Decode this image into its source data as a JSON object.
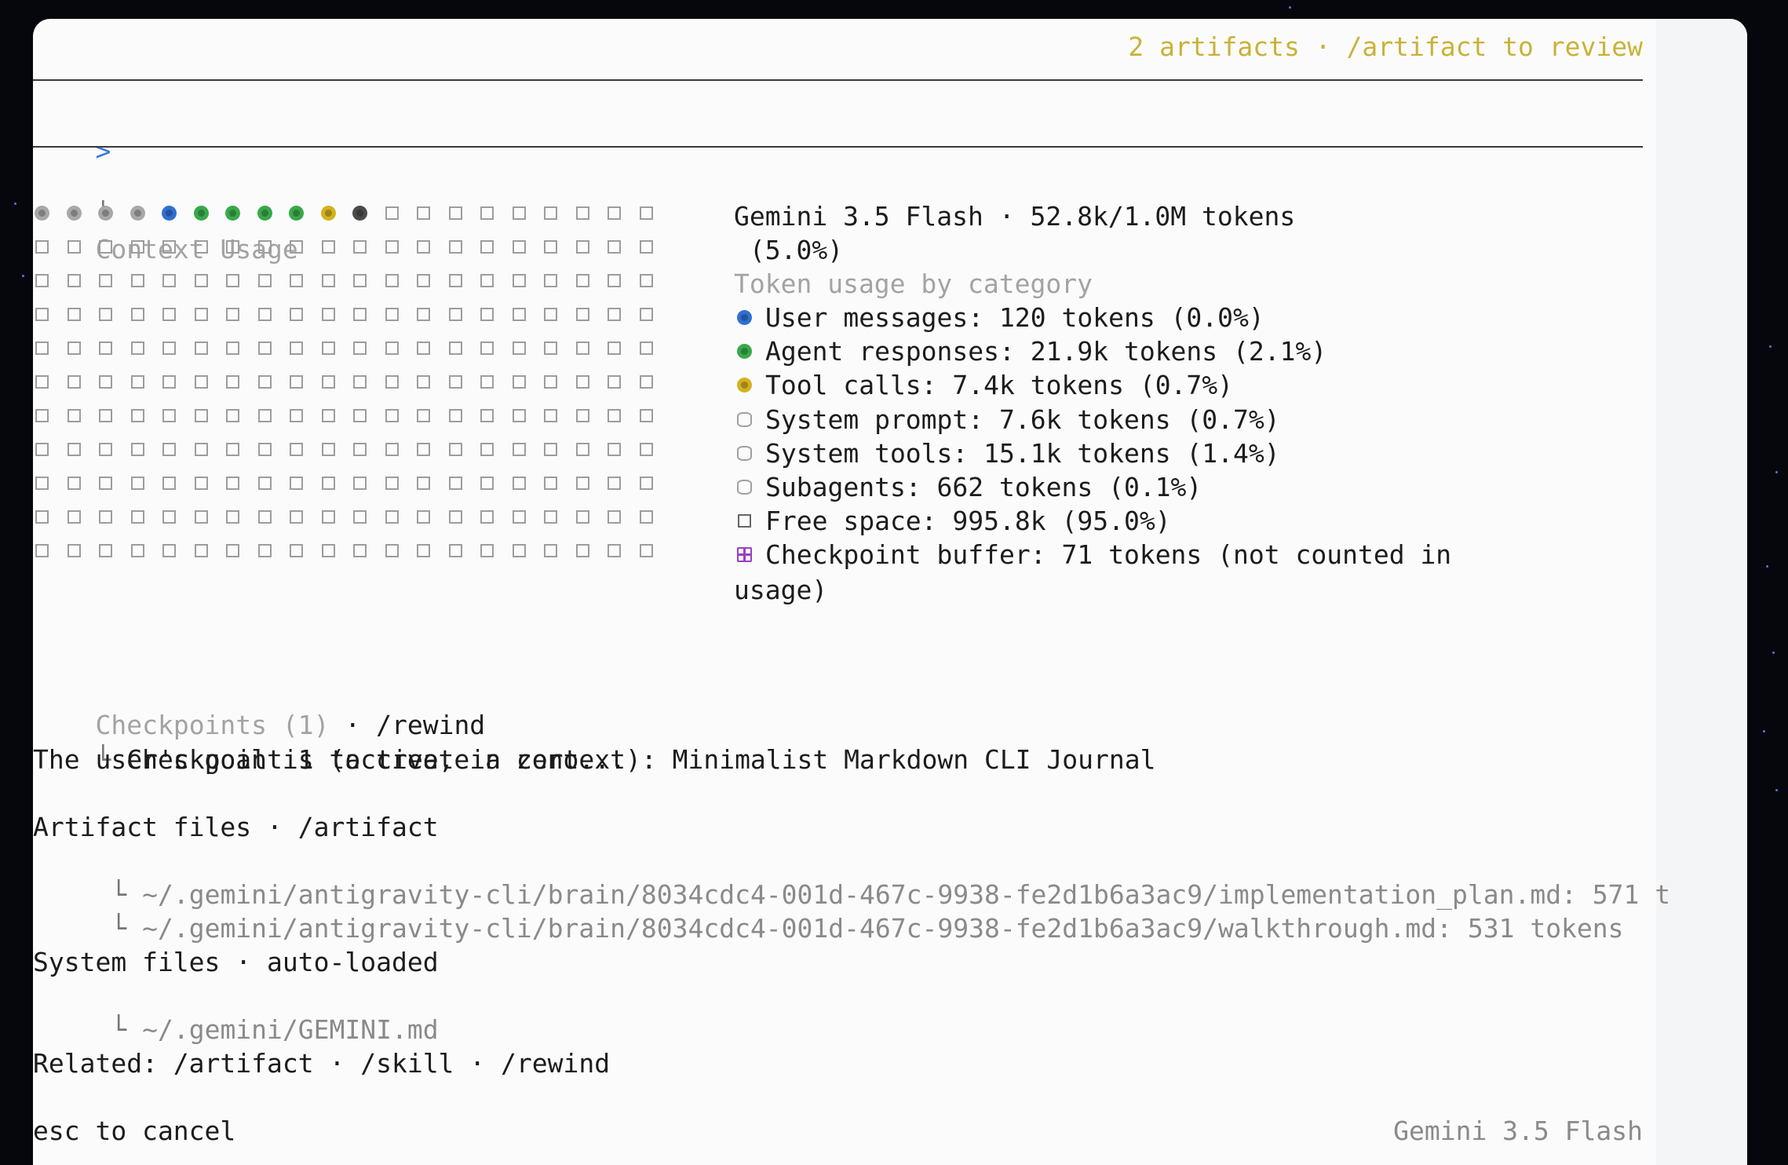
{
  "header": {
    "artifact_banner": "2 artifacts · /artifact to review"
  },
  "prompt": {
    "caret": ">"
  },
  "context_usage": {
    "heading_elbow": "└",
    "heading": "Context Usage",
    "grid": {
      "filled_cells": [
        {
          "category": "system",
          "color": "#a8a8a8"
        },
        {
          "category": "system",
          "color": "#a8a8a8"
        },
        {
          "category": "system",
          "color": "#a8a8a8"
        },
        {
          "category": "system",
          "color": "#a8a8a8"
        },
        {
          "category": "user",
          "color": "#2f6fd1"
        },
        {
          "category": "agent",
          "color": "#39a84a"
        },
        {
          "category": "agent",
          "color": "#39a84a"
        },
        {
          "category": "agent",
          "color": "#39a84a"
        },
        {
          "category": "agent",
          "color": "#39a84a"
        },
        {
          "category": "tool",
          "color": "#d3b11f"
        },
        {
          "category": "subagent",
          "color": "#4a4a4a"
        }
      ],
      "rows": 11,
      "columns": 20
    },
    "model_line": "Gemini 3.5 Flash · 52.8k/1.0M tokens",
    "percent_line": " (5.0%)",
    "category_heading": "Token usage by category",
    "categories": [
      {
        "marker": "circle",
        "color": "#2f6fd1",
        "label": "User messages: 120 tokens (0.0%)"
      },
      {
        "marker": "circle",
        "color": "#39a84a",
        "label": "Agent responses: 21.9k tokens (2.1%)"
      },
      {
        "marker": "circle",
        "color": "#d3b11f",
        "label": "Tool calls: 7.4k tokens (0.7%)"
      },
      {
        "marker": "db",
        "color": "#a0a0a0",
        "label": "System prompt: 7.6k tokens (0.7%)"
      },
      {
        "marker": "db",
        "color": "#a0a0a0",
        "label": "System tools: 15.1k tokens (1.4%)"
      },
      {
        "marker": "db",
        "color": "#a0a0a0",
        "label": "Subagents: 662 tokens (0.1%)"
      },
      {
        "marker": "empty",
        "color": "#666666",
        "label": "Free space: 995.8k (95.0%)"
      },
      {
        "marker": "plus",
        "color": "#9b3fc2",
        "label": "Checkpoint buffer: 71 tokens (not counted in"
      }
    ],
    "checkpoint_wrap": "usage)"
  },
  "checkpoints": {
    "heading_dim": "Checkpoints (1)",
    "heading_rest": " · /rewind",
    "elbow": "└",
    "item": " Checkpoint 1 (active, in context): Minimalist Markdown CLI Journal",
    "summary": "The user's goal is to create a zero..."
  },
  "artifact_files": {
    "heading": "Artifact files · /artifact",
    "items": [
      {
        "elbow": " └",
        "path": " ~/.gemini/antigravity-cli/brain/8034cdc4-001d-467c-9938-fe2d1b6a3ac9/implementation_plan.md: 571 t"
      },
      {
        "elbow": " └",
        "path": " ~/.gemini/antigravity-cli/brain/8034cdc4-001d-467c-9938-fe2d1b6a3ac9/walkthrough.md: 531 tokens"
      }
    ]
  },
  "system_files": {
    "heading": "System files · auto-loaded",
    "items": [
      {
        "elbow": " └",
        "path": " ~/.gemini/GEMINI.md"
      }
    ]
  },
  "related": "Related: /artifact · /skill · /rewind",
  "footer": {
    "cancel_hint": "esc to cancel",
    "model_name": "Gemini 3.5 Flash"
  }
}
